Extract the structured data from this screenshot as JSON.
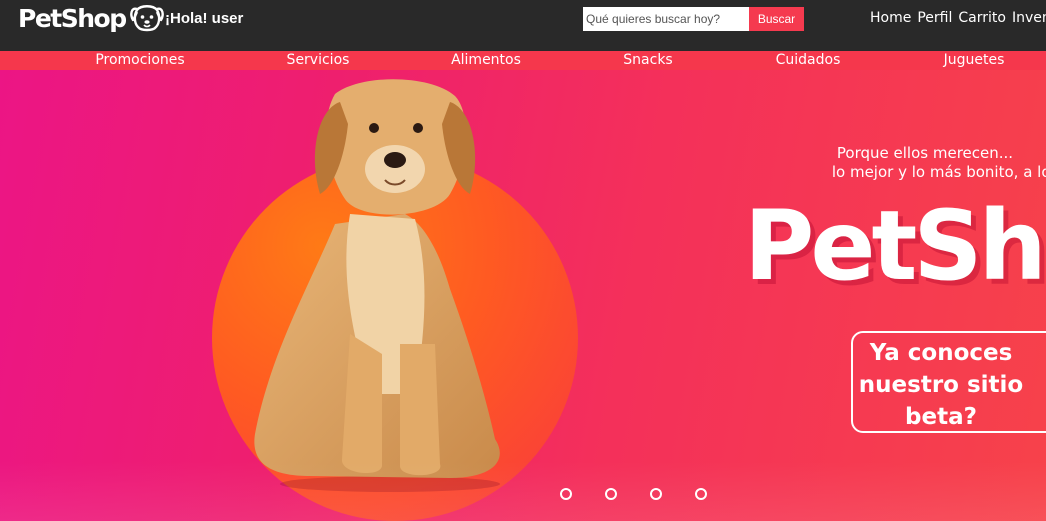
{
  "header": {
    "logo_text": "PetShop",
    "greeting": "¡Hola! user",
    "search": {
      "placeholder": "Qué quieres buscar hoy?",
      "button_label": "Buscar"
    },
    "nav": [
      "Home",
      "Perfil",
      "Carrito",
      "Invent"
    ]
  },
  "categories": [
    "Promociones",
    "Servicios",
    "Alimentos",
    "Snacks",
    "Cuidados",
    "Juguetes"
  ],
  "hero": {
    "tagline_line1": "Porque ellos merecen...",
    "tagline_line2": "lo mejor y lo más bonito, a los mejores",
    "brand": "PetShop",
    "cta_line1": "Ya conoces",
    "cta_line2": "nuestro sitio",
    "cta_line3": "beta?",
    "carousel_slides": 4,
    "active_slide": 0
  },
  "colors": {
    "header_bg": "#292929",
    "accent": "#f53a4f",
    "hero_gradient_start": "#ec1585",
    "hero_gradient_end": "#f7424a",
    "circle": "#ff5a22"
  },
  "icons": [
    "dog-face-icon"
  ]
}
